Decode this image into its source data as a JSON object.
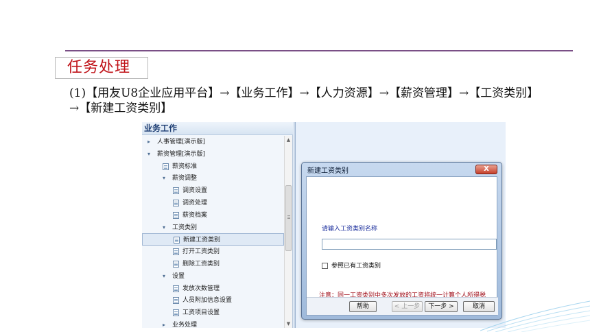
{
  "section": {
    "title": "任务处理",
    "instruction": "(1)【用友U8企业应用平台】→【业务工作】→【人力资源】→【薪资管理】→【工资类别】→【新建工资类别】"
  },
  "nav": {
    "header": "业务工作",
    "items": [
      {
        "label": "人事管理[演示版]",
        "type": "folder",
        "expanded": false
      },
      {
        "label": "薪资管理[演示版]",
        "type": "folder",
        "expanded": true
      },
      {
        "label": "薪资标准",
        "type": "doc"
      },
      {
        "label": "薪资调整",
        "type": "folder",
        "expanded": true
      },
      {
        "label": "调资设置",
        "type": "doc"
      },
      {
        "label": "调资处理",
        "type": "doc"
      },
      {
        "label": "薪资档案",
        "type": "doc"
      },
      {
        "label": "工资类别",
        "type": "folder",
        "expanded": true
      },
      {
        "label": "新建工资类别",
        "type": "doc",
        "selected": true
      },
      {
        "label": "打开工资类别",
        "type": "doc"
      },
      {
        "label": "删除工资类别",
        "type": "doc"
      },
      {
        "label": "设置",
        "type": "folder",
        "expanded": true
      },
      {
        "label": "发放次数管理",
        "type": "doc"
      },
      {
        "label": "人员附加信息设置",
        "type": "doc"
      },
      {
        "label": "工资项目设置",
        "type": "doc"
      },
      {
        "label": "业务处理",
        "type": "folder",
        "expanded": false
      }
    ]
  },
  "dialog": {
    "title": "新建工资类别",
    "close_label": "X",
    "prompt": "请输入工资类别名称",
    "name_value": "",
    "checkbox_label": "参照已有工资类别",
    "checkbox_checked": false,
    "notice": "注意：同一工资类别中多次发放的工资将统一计算个人所得税",
    "buttons": {
      "help": "帮助",
      "prev": "< 上一步",
      "next": "下一步 >",
      "cancel": "取消"
    }
  },
  "colors": {
    "accent_title": "#c0141a",
    "rule": "#7a4f86",
    "prompt": "#1a2d9c",
    "notice": "#a0101c"
  }
}
